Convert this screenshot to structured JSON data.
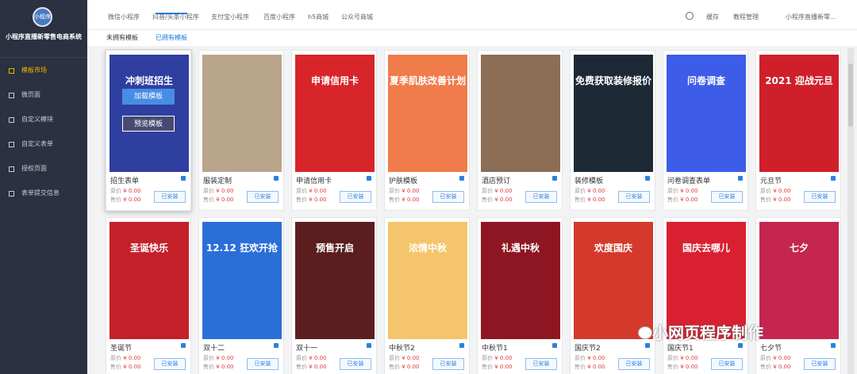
{
  "sidebar": {
    "logo_text": "小程序",
    "app_name": "小程序直播新零售电商系统",
    "items": [
      {
        "label": "模板市场",
        "active": true
      },
      {
        "label": "微页面"
      },
      {
        "label": "自定义模块"
      },
      {
        "label": "自定义表单"
      },
      {
        "label": "授权页面"
      },
      {
        "label": "表单提交信息"
      }
    ]
  },
  "header": {
    "tabs": [
      "微信小程序",
      "抖音/头条小程序",
      "支付宝小程序",
      "百度小程序",
      "h5商城",
      "公众号商城"
    ],
    "links": [
      "缓存",
      "教程管理",
      "小程序直播新零..."
    ]
  },
  "subtabs": [
    "未拥有模板",
    "已拥有模板"
  ],
  "overlay": {
    "load": "加载模板",
    "preview": "预览模板"
  },
  "labels": {
    "orig": "原价",
    "sale": "售价",
    "installed": "已安装"
  },
  "cards": [
    {
      "name": "招生表单",
      "orig": "¥ 0.00",
      "sale": "¥ 0.00",
      "bg": "#2e3fa0",
      "text": "冲刺班招生",
      "selected": true
    },
    {
      "name": "服装定制",
      "orig": "¥ 0.00",
      "sale": "¥ 0.00",
      "bg": "#b9a58c",
      "text": ""
    },
    {
      "name": "申请信用卡",
      "orig": "¥ 0.00",
      "sale": "¥ 0.00",
      "bg": "#d8252a",
      "text": "申请信用卡"
    },
    {
      "name": "护肤模板",
      "orig": "¥ 0.00",
      "sale": "¥ 0.00",
      "bg": "#f07b4b",
      "text": "夏季肌肤改善计划"
    },
    {
      "name": "酒店预订",
      "orig": "¥ 0.00",
      "sale": "¥ 0.00",
      "bg": "#8c6d55",
      "text": ""
    },
    {
      "name": "装修模板",
      "orig": "¥ 0.00",
      "sale": "¥ 0.00",
      "bg": "#1d2a35",
      "text": "免费获取装修报价"
    },
    {
      "name": "问卷调查表单",
      "orig": "¥ 0.00",
      "sale": "¥ 0.00",
      "bg": "#3d5ce8",
      "text": "问卷调查"
    },
    {
      "name": "元旦节",
      "orig": "¥ 0.00",
      "sale": "¥ 0.00",
      "bg": "#cf1f2a",
      "text": "2021 迎战元旦"
    },
    {
      "name": "圣诞节",
      "orig": "¥ 0.00",
      "sale": "¥ 0.00",
      "bg": "#c3202a",
      "text": "圣诞快乐"
    },
    {
      "name": "双十二",
      "orig": "¥ 0.00",
      "sale": "¥ 0.00",
      "bg": "#2a6fd8",
      "text": "12.12 狂欢开抢"
    },
    {
      "name": "双十一",
      "orig": "¥ 0.00",
      "sale": "¥ 0.00",
      "bg": "#5a1e1e",
      "text": "预售开启"
    },
    {
      "name": "中秋节2",
      "orig": "¥ 0.00",
      "sale": "¥ 0.00",
      "bg": "#f4c56a",
      "text": "浓情中秋"
    },
    {
      "name": "中秋节1",
      "orig": "¥ 0.00",
      "sale": "¥ 0.00",
      "bg": "#8e1622",
      "text": "礼遇中秋"
    },
    {
      "name": "国庆节2",
      "orig": "¥ 0.00",
      "sale": "¥ 0.00",
      "bg": "#d33a2c",
      "text": "欢度国庆"
    },
    {
      "name": "国庆节1",
      "orig": "¥ 0.00",
      "sale": "¥ 0.00",
      "bg": "#d82030",
      "text": "国庆去哪儿"
    },
    {
      "name": "七夕节",
      "orig": "¥ 0.00",
      "sale": "¥ 0.00",
      "bg": "#c4264f",
      "text": "七夕"
    }
  ],
  "watermark": "小网页程序制作"
}
